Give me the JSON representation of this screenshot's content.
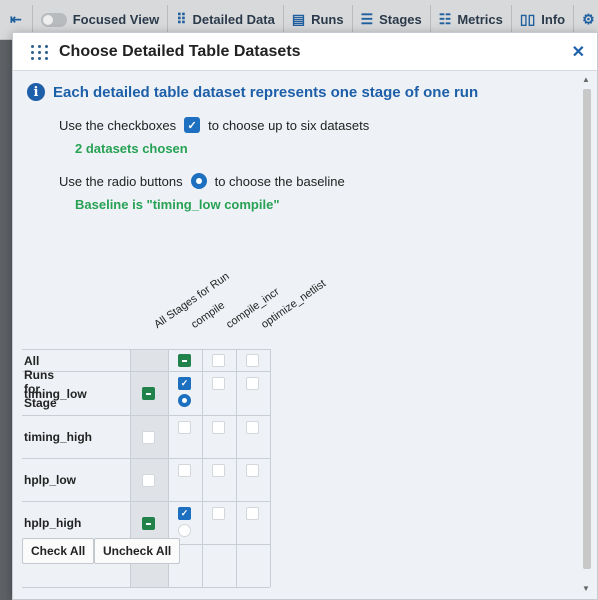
{
  "toolbar": {
    "focused_view": "Focused View",
    "detailed_data": "Detailed Data",
    "runs": "Runs",
    "stages": "Stages",
    "metrics": "Metrics",
    "info": "Info"
  },
  "dialog": {
    "title": "Choose Detailed Table Datasets",
    "info_heading": "Each detailed table dataset represents one stage of one run",
    "checkbox_instr_before": "Use the checkboxes",
    "checkbox_instr_after": "to choose up to six datasets",
    "datasets_chosen": "2 datasets chosen",
    "radio_instr_before": "Use the radio buttons",
    "radio_instr_after": "to choose the baseline",
    "baseline_note": "Baseline is \"timing_low compile\""
  },
  "table": {
    "corner_label": "All Runs for Stage",
    "all_stages_header": "All Stages for Run",
    "stages": [
      "compile",
      "compile_incr",
      "optimize_netlist"
    ],
    "runs": [
      "timing_low",
      "timing_high",
      "hplp_low",
      "hplp_high"
    ],
    "all_runs_state": [
      "indeterminate",
      "unchecked",
      "unchecked"
    ],
    "run_all_state": [
      "indeterminate",
      "unchecked",
      "unchecked",
      "indeterminate"
    ],
    "cells": [
      [
        {
          "checked": true,
          "radio": "on"
        },
        {
          "checked": false
        },
        {
          "checked": false
        }
      ],
      [
        {
          "checked": false
        },
        {
          "checked": false
        },
        {
          "checked": false
        }
      ],
      [
        {
          "checked": false
        },
        {
          "checked": false
        },
        {
          "checked": false
        }
      ],
      [
        {
          "checked": true,
          "radio": "off"
        },
        {
          "checked": false
        },
        {
          "checked": false
        }
      ]
    ]
  },
  "buttons": {
    "check_all": "Check All",
    "uncheck_all": "Uncheck All"
  }
}
